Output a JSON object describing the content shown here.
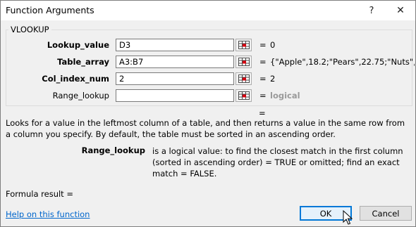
{
  "window": {
    "title": "Function Arguments",
    "help_glyph": "?",
    "close_glyph": "✕"
  },
  "function_name": "VLOOKUP",
  "arguments": [
    {
      "label": "Lookup_value",
      "value": "D3",
      "equals": "=",
      "result": "0",
      "bold": true
    },
    {
      "label": "Table_array",
      "value": "A3:B7",
      "equals": "=",
      "result": "{\"Apple\",18.2;\"Pears\",22.75;\"Nuts\",57.2",
      "bold": true
    },
    {
      "label": "Col_index_num",
      "value": "2",
      "equals": "=",
      "result": "2",
      "bold": true
    },
    {
      "label": "Range_lookup",
      "value": "",
      "equals": "=",
      "result": "logical",
      "bold": false
    }
  ],
  "overall_equals": "=",
  "description": "Looks for a value in the leftmost column of a table, and then returns a value in the same row from a column you specify. By default, the table must be sorted in an ascending order.",
  "argument_help": {
    "name": "Range_lookup",
    "text": "is a logical value: to find the closest match in the first column (sorted in ascending order) = TRUE or omitted; find an exact match = FALSE."
  },
  "formula_result_label": "Formula result =",
  "help_link": "Help on this function",
  "buttons": {
    "ok": "OK",
    "cancel": "Cancel"
  },
  "colors": {
    "accent": "#0078d7",
    "link": "#0066cc"
  }
}
